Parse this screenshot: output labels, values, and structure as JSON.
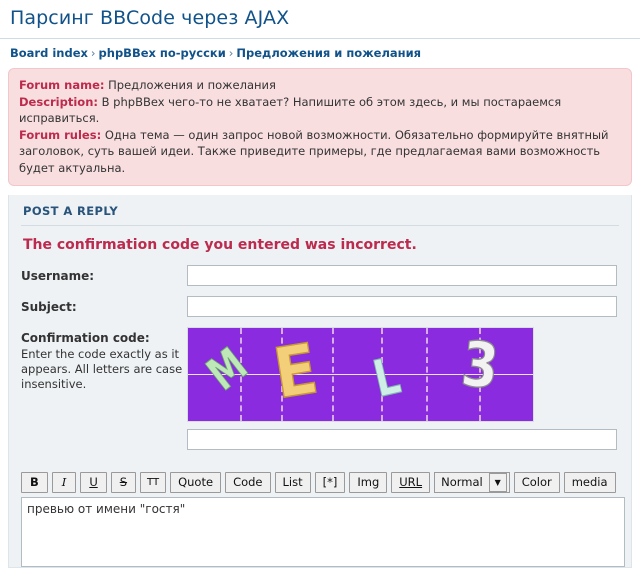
{
  "header": {
    "title": "Парсинг BBCode через AJAX"
  },
  "breadcrumb": {
    "items": [
      {
        "label": "Board index",
        "link": true
      },
      {
        "label": "phpBBex по-русски",
        "link": true
      },
      {
        "label": "Предложения и пожелания",
        "link": false
      }
    ],
    "separator": "›"
  },
  "rules_box": {
    "forum_name_label": "Forum name:",
    "forum_name_value": "Предложения и пожелания",
    "description_label": "Description:",
    "description_value": "В phpBBex чего-то не хватает? Напишите об этом здесь, и мы постараемся исправиться.",
    "rules_label": "Forum rules:",
    "rules_value": "Одна тема — один запрос новой возможности. Обязательно формируйте внятный заголовок, суть вашей идеи. Также приведите примеры, где предлагаемая вами возможность будет актуальна."
  },
  "post_form": {
    "panel_title": "POST A REPLY",
    "error_message": "The confirmation code you entered was incorrect.",
    "username_label": "Username:",
    "username_value": "",
    "subject_label": "Subject:",
    "subject_value": "",
    "confirmation_label": "Confirmation code:",
    "confirmation_hint": "Enter the code exactly as it appears. All letters are case insensitive.",
    "confirmation_value": "",
    "captcha": {
      "characters": [
        "M",
        "E",
        "L",
        "3"
      ],
      "background_color": "#8a2be0",
      "line_color": "#f3e6f3"
    },
    "body_value": "превью от имени \"гостя\""
  },
  "bbcode_toolbar": {
    "buttons": [
      {
        "label": "B",
        "name": "bold"
      },
      {
        "label": "I",
        "name": "italic"
      },
      {
        "label": "U",
        "name": "underline"
      },
      {
        "label": "S",
        "name": "strikethrough"
      },
      {
        "label": "TT",
        "name": "teletype"
      },
      {
        "label": "Quote",
        "name": "quote"
      },
      {
        "label": "Code",
        "name": "code"
      },
      {
        "label": "List",
        "name": "list"
      },
      {
        "label": "[*]",
        "name": "list-item"
      },
      {
        "label": "Img",
        "name": "image"
      },
      {
        "label": "URL",
        "name": "url"
      }
    ],
    "font_size_selected": "Normal",
    "font_size_arrow": "▼",
    "color_label": "Color",
    "media_label": "media"
  },
  "colors": {
    "title": "#105289",
    "link": "#105289",
    "error": "#bc2a4d",
    "rules_bg": "#f9dee0",
    "panel_bg": "#eef2f5"
  }
}
